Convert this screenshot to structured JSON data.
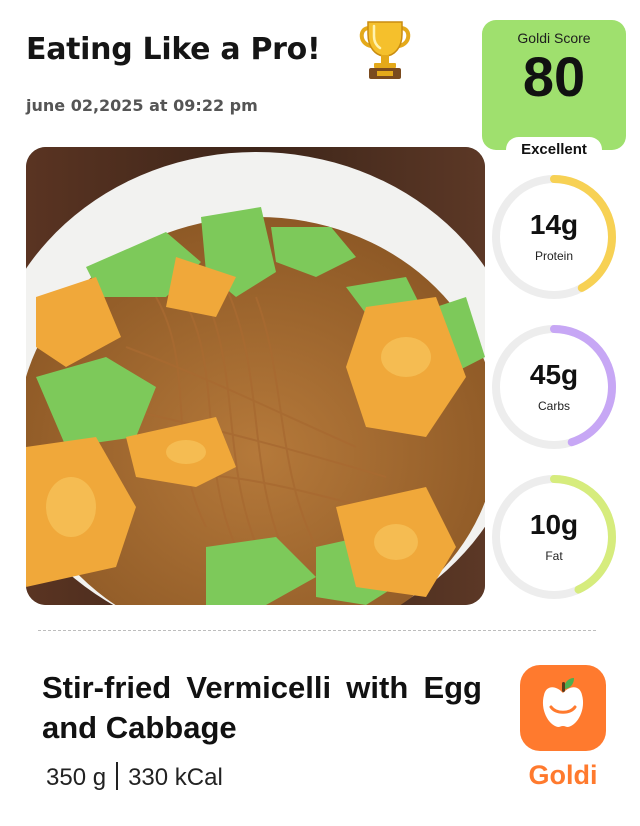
{
  "header": {
    "title": "Eating Like a Pro!",
    "trophy_icon": "trophy-icon",
    "timestamp": "june 02,2025 at 09:22 pm"
  },
  "score": {
    "label": "Goldi Score",
    "value": "80",
    "rating": "Excellent",
    "color": "#9fe06e"
  },
  "macros": [
    {
      "value": "14g",
      "label": "Protein",
      "fraction": 0.42,
      "color": "#f7d154"
    },
    {
      "value": "45g",
      "label": "Carbs",
      "fraction": 0.45,
      "color": "#c7a7f5"
    },
    {
      "value": "10g",
      "label": "Fat",
      "fraction": 0.43,
      "color": "#d6ec7d"
    }
  ],
  "dish": {
    "name": "Stir-fried Vermicelli with Egg and Cabbage",
    "weight": "350 g",
    "calories": "330 kCal"
  },
  "app": {
    "name": "Goldi",
    "icon": "apple-logo-icon",
    "color": "#ff7a2e"
  }
}
